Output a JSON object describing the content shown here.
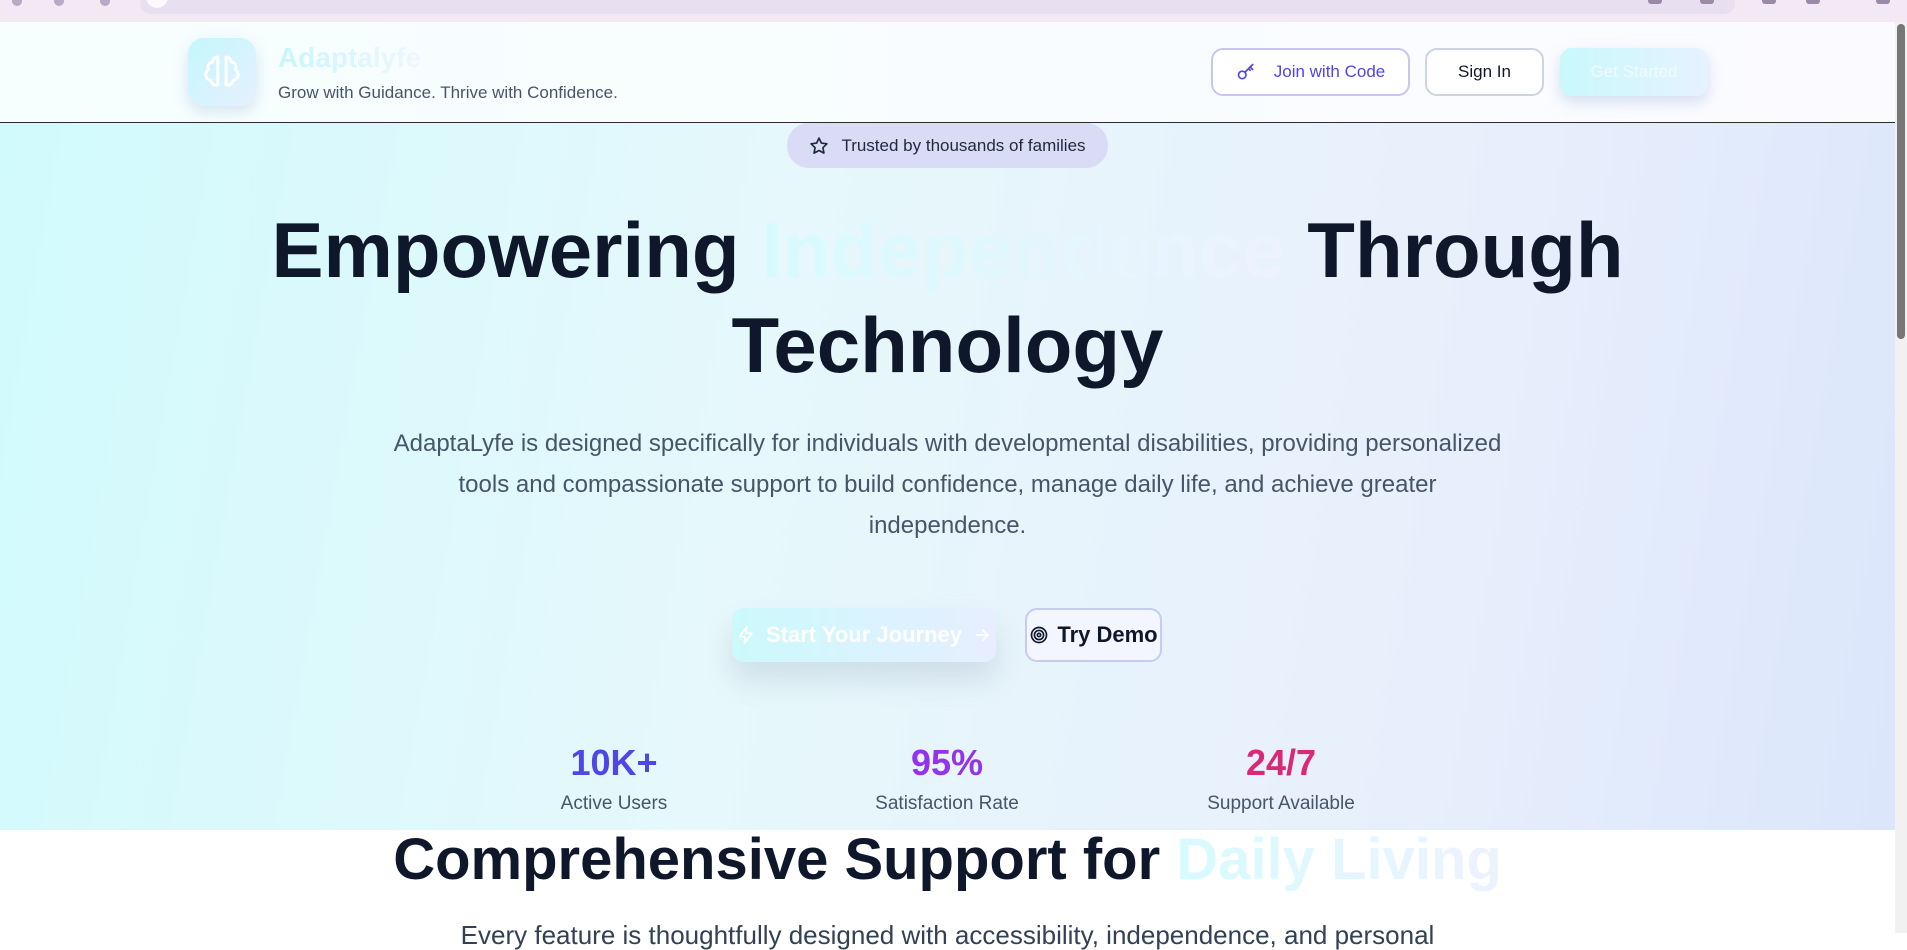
{
  "header": {
    "brand": "Adaptalyfe",
    "tagline": "Grow with Guidance. Thrive with Confidence.",
    "join_label": "Join with Code",
    "signin_label": "Sign In",
    "get_started_label": "Get Started"
  },
  "hero": {
    "badge": "Trusted by thousands of families",
    "title_part1": "Empowering",
    "title_highlight": "Independence",
    "title_part2": "Through",
    "title_line2": "Technology",
    "description": "AdaptaLyfe is designed specifically for individuals with developmental disabilities, providing personalized tools and compassionate support to build confidence, manage daily life, and achieve greater independence.",
    "primary_cta": "Start Your Journey",
    "demo_cta": "Try Demo"
  },
  "stats": [
    {
      "value": "10K+",
      "label": "Active Users"
    },
    {
      "value": "95%",
      "label": "Satisfaction Rate"
    },
    {
      "value": "24/7",
      "label": "Support Available"
    }
  ],
  "features": {
    "title_part1": "Comprehensive Support for",
    "title_highlight": "Daily Living",
    "subtitle": "Every feature is thoughtfully designed with accessibility, independence, and personal"
  },
  "colors": {
    "stat1": "#4f46e5",
    "stat2": "#9333ea",
    "stat3": "#db2777",
    "accent": "#4f46e5"
  },
  "icons": {
    "logo": "brain-icon",
    "join": "key-icon",
    "badge": "star-icon",
    "primary_cta_left": "zap-icon",
    "primary_cta_right": "arrow-right-icon",
    "demo": "target-icon"
  }
}
